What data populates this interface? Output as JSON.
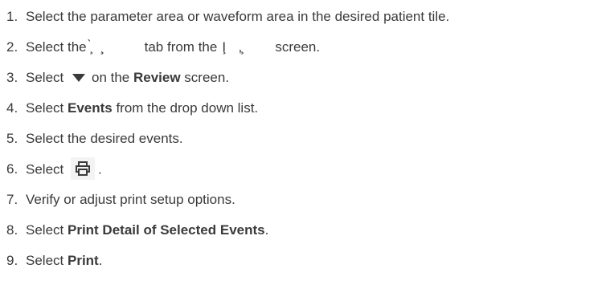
{
  "steps": [
    {
      "number": "1.",
      "parts": [
        {
          "t": "Select the parameter area or waveform area in the desired patient tile."
        }
      ]
    },
    {
      "number": "2.",
      "parts": [
        {
          "t": "Select the"
        },
        {
          "garble": "̧̀  ̧̧"
        },
        {
          "t": "tab from the"
        },
        {
          "garble": "I̧  ,̧"
        },
        {
          "t": "screen."
        }
      ]
    },
    {
      "number": "3.",
      "parts": [
        {
          "t": "Select "
        },
        {
          "icon": "dropdown-triangle-icon"
        },
        {
          "t": "on the "
        },
        {
          "b": "Review"
        },
        {
          "t": " screen."
        }
      ]
    },
    {
      "number": "4.",
      "parts": [
        {
          "t": "Select "
        },
        {
          "b": "Events"
        },
        {
          "t": " from the drop down list."
        }
      ]
    },
    {
      "number": "5.",
      "parts": [
        {
          "t": "Select the desired events."
        }
      ]
    },
    {
      "number": "6.",
      "parts": [
        {
          "t": "Select "
        },
        {
          "icon": "printer-icon"
        },
        {
          "t": "."
        }
      ]
    },
    {
      "number": "7.",
      "parts": [
        {
          "t": "Verify or adjust print setup options."
        }
      ]
    },
    {
      "number": "8.",
      "parts": [
        {
          "t": "Select "
        },
        {
          "b": "Print Detail of Selected Events"
        },
        {
          "t": "."
        }
      ]
    },
    {
      "number": "9.",
      "parts": [
        {
          "t": "Select "
        },
        {
          "b": "Print"
        },
        {
          "t": "."
        }
      ]
    }
  ],
  "colors": {
    "text": "#3a3a3a",
    "icon_background": "#f3f3f3"
  }
}
